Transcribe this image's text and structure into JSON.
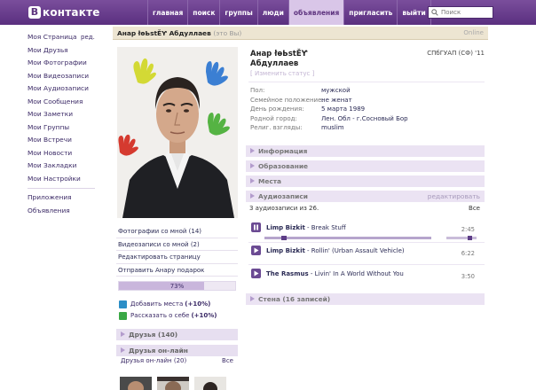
{
  "header": {
    "logo_text": "контакте",
    "logo_badge": "В",
    "nav": [
      "главная",
      "поиск",
      "группы",
      "люди",
      "объявления",
      "пригласить",
      "выйти"
    ],
    "active_nav": "объявления",
    "search_placeholder": "Поиск"
  },
  "left_menu": {
    "items": [
      "Моя Страница",
      "Мои Друзья",
      "Мои Фотографии",
      "Мои Видеозаписи",
      "Мои Аудиозаписи",
      "Мои Сообщения",
      "Мои Заметки",
      "Мои Группы",
      "Мои Встречи",
      "Мои Новости",
      "Мои Закладки",
      "Мои Настройки"
    ],
    "edit_label": "ред.",
    "extra": [
      "Приложения",
      "Объявления"
    ]
  },
  "profile_bar": {
    "name": "Анар łѳЬѕtĚƳ Абдуллаев",
    "you_note": "(это Вы)",
    "status": "Online"
  },
  "profile": {
    "name_line1": "Анар łѳЬѕtĚƳ",
    "name_line2": "Абдуллаев",
    "status_placeholder": "[ Изменить статус ]",
    "univ": "СПбГУАП (СФ) '11",
    "info": [
      {
        "k": "Пол:",
        "v": "мужской"
      },
      {
        "k": "Семейное положение:",
        "v": "не женат"
      },
      {
        "k": "День рождения:",
        "v": "5 марта 1989"
      },
      {
        "k": "Родной город:",
        "v": "Лен. Обл - г.Сосновый Бор"
      },
      {
        "k": "Религ. взгляды:",
        "v": "muslim"
      }
    ]
  },
  "sections": {
    "info": "Информация",
    "education": "Образование",
    "places": "Места",
    "audio": "Аудиозаписи",
    "audio_edit": "редактировать",
    "audio_sub": "3 аудиозаписи из 26.",
    "audio_all": "Все",
    "wall": "Стена (16 записей)"
  },
  "tracks": [
    {
      "artist": "Limp Bizkit",
      "title": "Break Stuff",
      "duration": "2:45",
      "playing": true
    },
    {
      "artist": "Limp Bizkit",
      "title": "Rollin' (Urban Assault Vehicle)",
      "duration": "6:22",
      "playing": false
    },
    {
      "artist": "The Rasmus",
      "title": "Livin' In A World Without You",
      "duration": "3:50",
      "playing": false
    }
  ],
  "player": {
    "position_fraction": 0.1,
    "volume_fraction": 0.75
  },
  "left_links": [
    "Фотографии со мной (14)",
    "Видеозаписи со мной (2)",
    "Редактировать страницу",
    "Отправить Анару подарок"
  ],
  "completeness": {
    "label": "73%",
    "value": 73
  },
  "tips": [
    {
      "text": "Добавить места",
      "bonus": "(+10%)",
      "color": "#2b8ec6"
    },
    {
      "text": "Рассказать о себе",
      "bonus": "(+10%)",
      "color": "#3aa845"
    }
  ],
  "friends": {
    "header": "Друзья (140)",
    "online_header": "Друзья он-лайн",
    "online_sub": "Друзья он-лайн (20)",
    "all": "Все"
  },
  "colors": {
    "header": "#5e347f",
    "accent": "#6b4a93",
    "bar": "#ebe3f3"
  }
}
